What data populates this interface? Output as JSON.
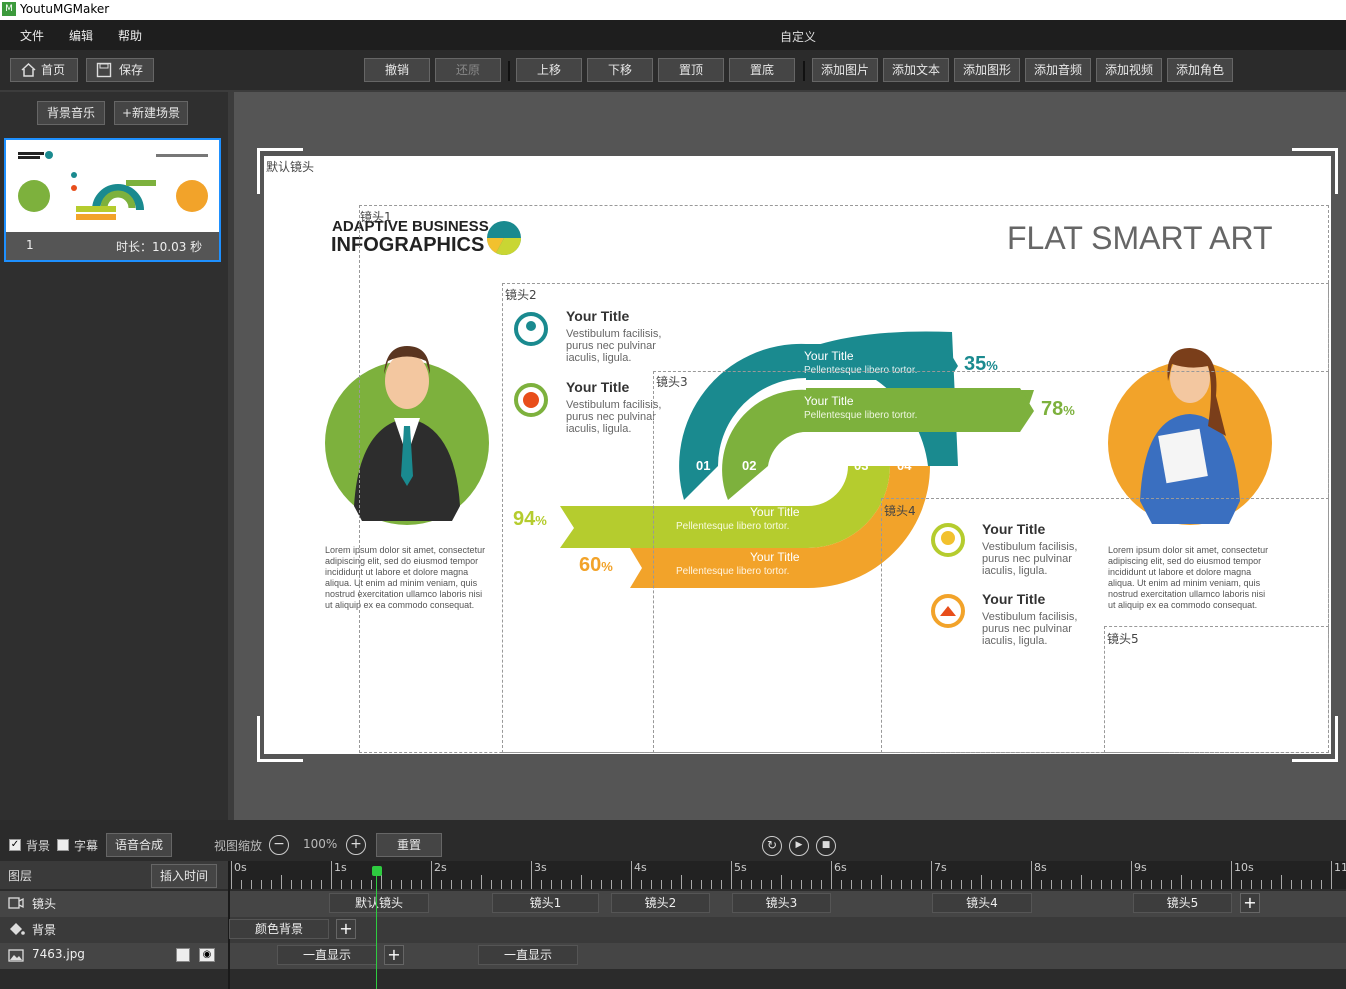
{
  "app": {
    "title": "YoutuMGMaker",
    "icon": "app-logo-icon"
  },
  "menu": {
    "items": [
      "文件",
      "编辑",
      "帮助"
    ],
    "center": "自定义"
  },
  "toolbar": {
    "home": "首页",
    "save": "保存",
    "undo": "撤销",
    "redo": "还原",
    "up": "上移",
    "down": "下移",
    "top": "置顶",
    "bottom": "置底",
    "add_image": "添加图片",
    "add_text": "添加文本",
    "add_shape": "添加图形",
    "add_audio": "添加音频",
    "add_video": "添加视频",
    "add_role": "添加角色"
  },
  "scenes": {
    "bg_music": "背景音乐",
    "new_scene": "+新建场景",
    "items": [
      {
        "index": "1",
        "duration": "时长：10.03 秒"
      }
    ]
  },
  "stage": {
    "cameras": [
      "默认镜头",
      "镜头1",
      "镜头2",
      "镜头3",
      "镜头4",
      "镜头5"
    ]
  },
  "infographic": {
    "brand_line1": "ADAPTIVE BUSINESS",
    "brand_line2": "INFOGRAPHICS",
    "headline": "FLAT SMART ART",
    "left_items": [
      {
        "title": "Your Title",
        "body": "Vestibulum facilisis, purus nec pulvinar iaculis, ligula."
      },
      {
        "title": "Your Title",
        "body": "Vestibulum facilisis, purus nec pulvinar iaculis, ligula."
      }
    ],
    "right_items": [
      {
        "title": "Your Title",
        "body": "Vestibulum facilisis, purus nec pulvinar iaculis, ligula."
      },
      {
        "title": "Your Title",
        "body": "Vestibulum facilisis, purus nec pulvinar iaculis, ligula."
      }
    ],
    "bands": [
      {
        "title": "Your Title",
        "sub": "Pellentesque libero tortor.",
        "pct": "35",
        "color": "#1a8a8f"
      },
      {
        "title": "Your Title",
        "sub": "Pellentesque libero tortor.",
        "pct": "78",
        "color": "#7db13d"
      },
      {
        "title": "Your Title",
        "sub": "Pellentesque libero tortor.",
        "pct": "94",
        "color": "#b5cc2e"
      },
      {
        "title": "Your Title",
        "sub": "Pellentesque libero tortor.",
        "pct": "60",
        "color": "#f2a32a"
      }
    ],
    "pct_sign": "%",
    "numbers": [
      "01",
      "02",
      "03",
      "04"
    ],
    "lorem": "Lorem ipsum dolor sit amet, consectetur adipiscing elit, sed do eiusmod tempor incididunt ut labore et dolore magna aliqua. Ut enim ad minim veniam, quis nostrud exercitation ullamco laboris nisi ut aliquip ex ea commodo consequat."
  },
  "bottom": {
    "bg_label": "背景",
    "sub_label": "字幕",
    "tts": "语音合成",
    "zoom_label": "视图缩放",
    "zoom": "100%",
    "reset": "重置",
    "layers": "图层",
    "insert_time": "插入时间",
    "ticks": [
      "0s",
      "1s",
      "2s",
      "3s",
      "4s",
      "5s",
      "6s",
      "7s",
      "8s",
      "9s",
      "10s",
      "11"
    ]
  },
  "tracks": {
    "camera": {
      "name": "镜头",
      "blocks": [
        "默认镜头",
        "镜头1",
        "镜头2",
        "镜头3",
        "镜头4",
        "镜头5"
      ]
    },
    "background": {
      "name": "背景",
      "blocks": [
        "颜色背景"
      ]
    },
    "image": {
      "name": "7463.jpg",
      "blocks": [
        "一直显示",
        "一直显示"
      ]
    }
  }
}
